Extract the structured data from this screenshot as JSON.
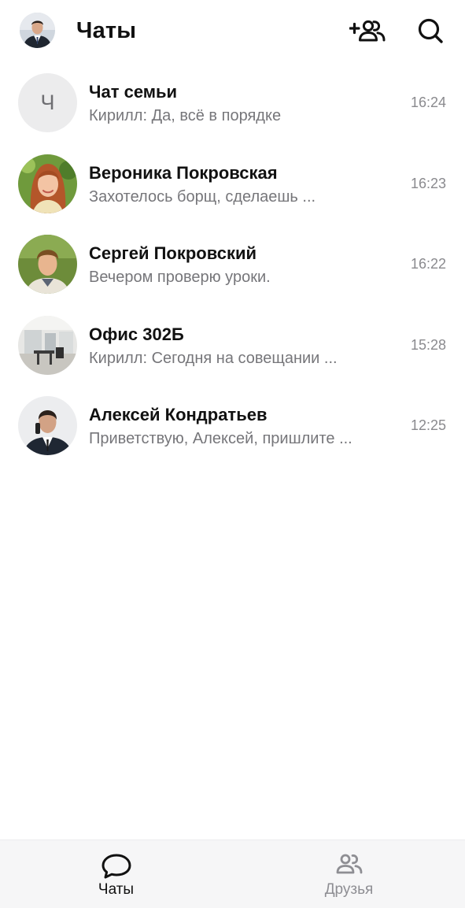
{
  "header": {
    "title": "Чаты",
    "add_friend_icon": "add-user-icon",
    "search_icon": "search-icon"
  },
  "chats": [
    {
      "name": "Чат семьи",
      "preview": "Кирилл: Да, всё в порядке",
      "time": "16:24",
      "avatar_letter": "Ч"
    },
    {
      "name": "Вероника Покровская",
      "preview": "Захотелось борщ, сделаешь ...",
      "time": "16:23"
    },
    {
      "name": "Сергей Покровский",
      "preview": "Вечером проверю уроки.",
      "time": "16:22"
    },
    {
      "name": "Офис 302Б",
      "preview": "Кирилл: Сегодня на совещании ...",
      "time": "15:28"
    },
    {
      "name": "Алексей Кондратьев",
      "preview": "Приветствую, Алексей, пришлите ...",
      "time": "12:25"
    }
  ],
  "bottom_nav": {
    "chats_label": "Чаты",
    "friends_label": "Друзья",
    "active": "chats"
  },
  "colors": {
    "text_primary": "#111111",
    "text_secondary": "#76767a",
    "time": "#8a8a8e",
    "nav_background": "#f6f6f7",
    "nav_inactive": "#8e8e93"
  }
}
